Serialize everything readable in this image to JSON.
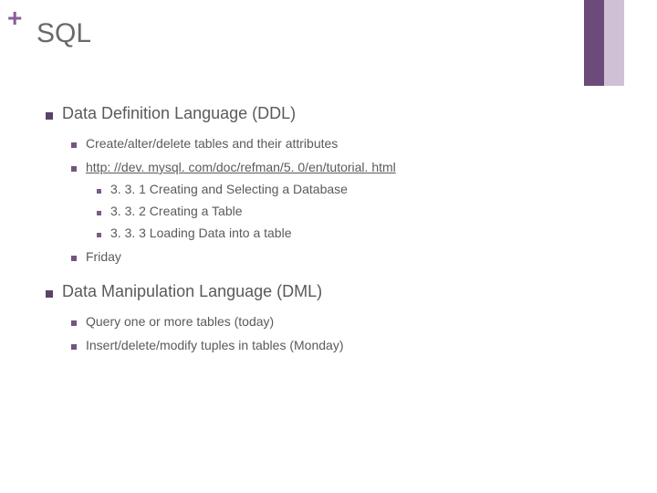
{
  "plus_symbol": "+",
  "title": "SQL",
  "bullets": {
    "ddl": {
      "label": "Data Definition Language (DDL)",
      "items": {
        "create": "Create/alter/delete tables and their attributes",
        "link": "http: //dev. mysql. com/doc/refman/5. 0/en/tutorial. html",
        "sub": {
          "a": "3. 3. 1 Creating and Selecting a Database",
          "b": "3. 3. 2 Creating a Table",
          "c": "3. 3. 3 Loading Data into a table"
        },
        "friday": "Friday"
      }
    },
    "dml": {
      "label": "Data Manipulation Language (DML)",
      "items": {
        "query": "Query one or more tables (today)",
        "insert": "Insert/delete/modify tuples in tables (Monday)"
      }
    }
  }
}
